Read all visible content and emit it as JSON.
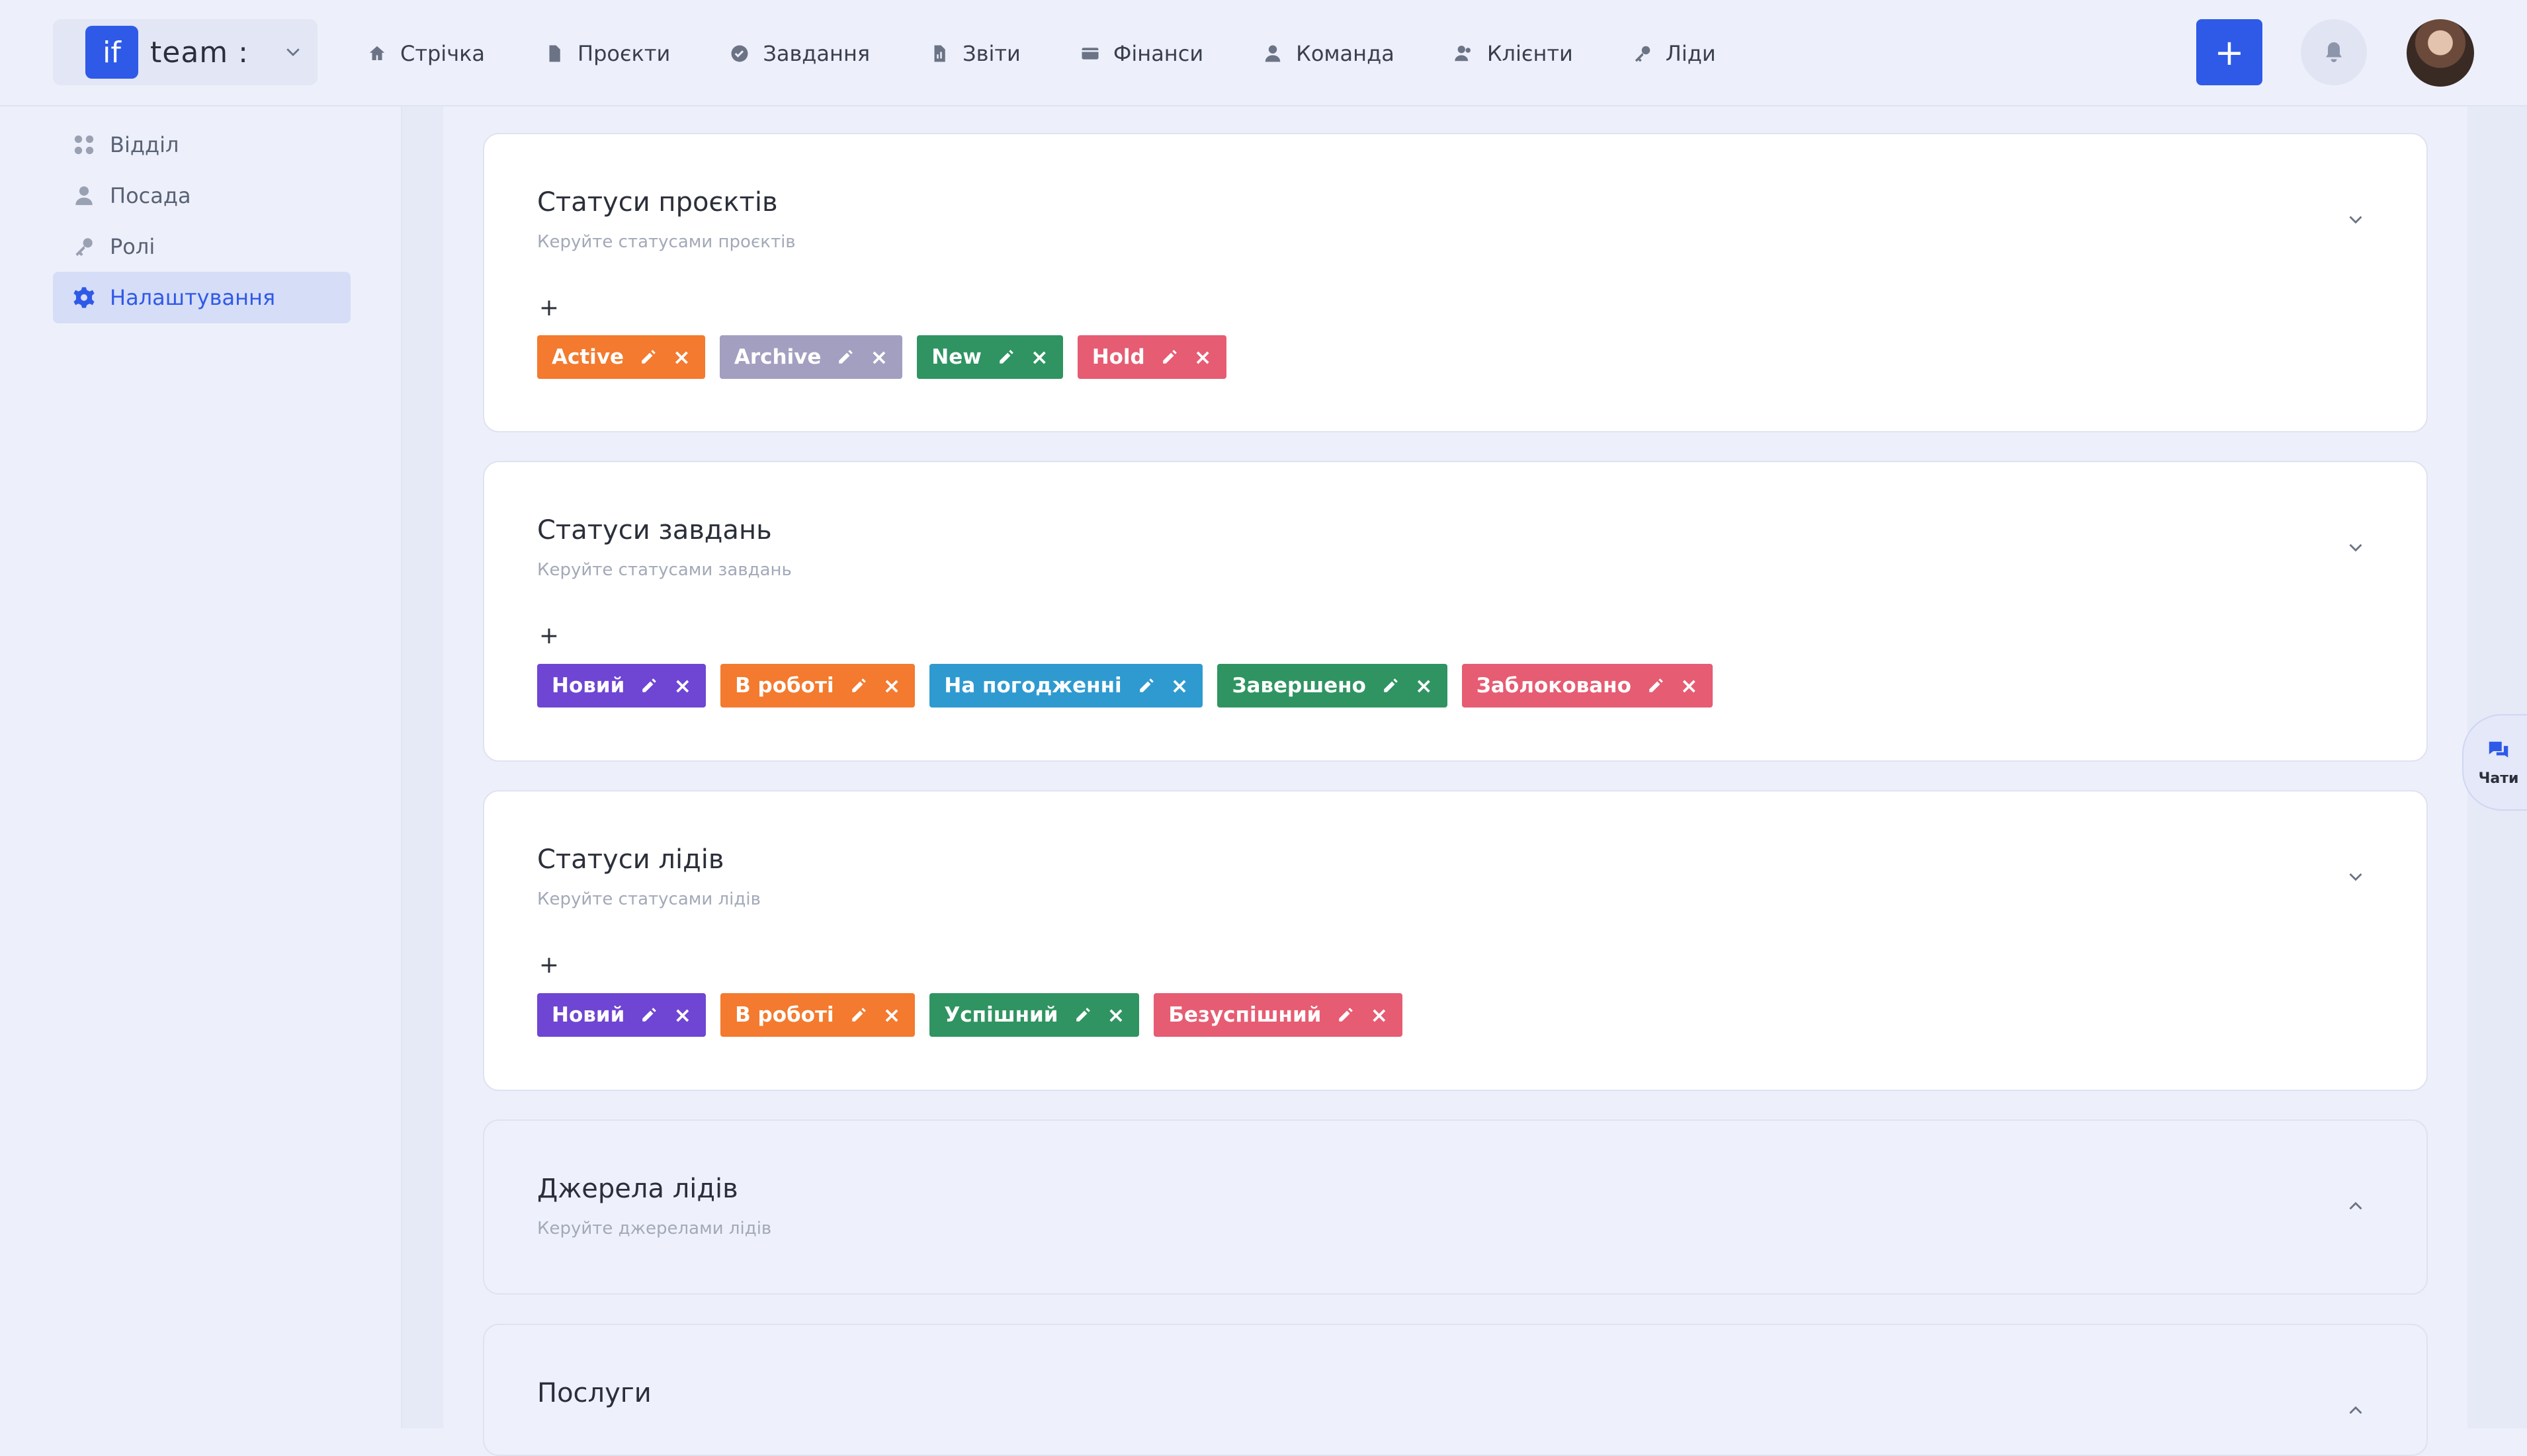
{
  "brand": {
    "logo_text": "if",
    "name": "team :"
  },
  "nav": [
    {
      "label": "Стрічка",
      "icon": "home-icon"
    },
    {
      "label": "Проєкти",
      "icon": "document-icon"
    },
    {
      "label": "Завдання",
      "icon": "check-circle-icon"
    },
    {
      "label": "Звіти",
      "icon": "report-icon"
    },
    {
      "label": "Фінанси",
      "icon": "wallet-icon"
    },
    {
      "label": "Команда",
      "icon": "user-icon"
    },
    {
      "label": "Клієнти",
      "icon": "users-icon"
    },
    {
      "label": "Ліди",
      "icon": "key-icon"
    }
  ],
  "header": {
    "plus_label": "+"
  },
  "sidebar": {
    "items": [
      {
        "label": "Відділ",
        "icon": "grid-icon"
      },
      {
        "label": "Посада",
        "icon": "user-icon"
      },
      {
        "label": "Ролі",
        "icon": "key-icon"
      },
      {
        "label": "Налаштування",
        "icon": "gear-icon",
        "active": true
      }
    ]
  },
  "sections": [
    {
      "title": "Статуси проєктів",
      "subtitle": "Керуйте статусами проєктів",
      "add": "+",
      "tags": [
        {
          "label": "Active",
          "color": "#f37a2e"
        },
        {
          "label": "Archive",
          "color": "#a29fc0"
        },
        {
          "label": "New",
          "color": "#2f9461"
        },
        {
          "label": "Hold",
          "color": "#e65c72"
        }
      ]
    },
    {
      "title": "Статуси завдань",
      "subtitle": "Керуйте статусами завдань",
      "add": "+",
      "tags": [
        {
          "label": "Новий",
          "color": "#6f45d3"
        },
        {
          "label": "В роботі",
          "color": "#f37a2e"
        },
        {
          "label": "На погодженні",
          "color": "#2f9ad0"
        },
        {
          "label": "Завершено",
          "color": "#2f9461"
        },
        {
          "label": "Заблоковано",
          "color": "#e65c72"
        }
      ]
    },
    {
      "title": "Статуси лідів",
      "subtitle": "Керуйте статусами лідів",
      "add": "+",
      "tags": [
        {
          "label": "Новий",
          "color": "#6f45d3"
        },
        {
          "label": "В роботі",
          "color": "#f37a2e"
        },
        {
          "label": "Успішний",
          "color": "#2f9461"
        },
        {
          "label": "Безуспішний",
          "color": "#e65c72"
        }
      ]
    },
    {
      "title": "Джерела лідів",
      "subtitle": "Керуйте джерелами лідів"
    },
    {
      "title": "Послуги"
    }
  ],
  "tag_delete": "×",
  "chat": {
    "label": "Чати"
  }
}
